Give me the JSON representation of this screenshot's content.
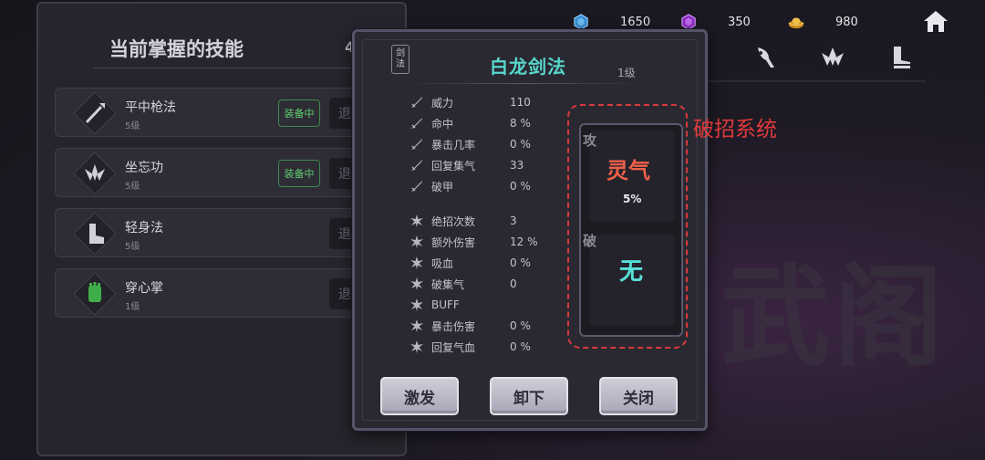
{
  "background": {
    "watermark": "武阁"
  },
  "currency": [
    {
      "icon": "blue-gem-icon",
      "value": "1650",
      "color": "#4aa6e0"
    },
    {
      "icon": "purple-gem-icon",
      "value": "350",
      "color": "#b04ae0"
    },
    {
      "icon": "gold-ingot-icon",
      "value": "980",
      "color": "#e0a83a"
    }
  ],
  "skills_panel": {
    "title": "当前掌握的技能",
    "count": "4",
    "items": [
      {
        "name": "平中枪法",
        "level": "5级",
        "equipped": "装备中",
        "action": "退",
        "icon": "spear-icon"
      },
      {
        "name": "坐忘功",
        "level": "5级",
        "equipped": "装备中",
        "action": "退",
        "icon": "lotus-icon"
      },
      {
        "name": "轻身法",
        "level": "5级",
        "equipped": "",
        "action": "退",
        "icon": "boot-icon"
      },
      {
        "name": "穿心掌",
        "level": "1级",
        "equipped": "",
        "action": "退",
        "icon": "palm-icon"
      }
    ]
  },
  "modal": {
    "category": "剑法",
    "title": "白龙剑法",
    "level": "1级",
    "weapon_stats": [
      {
        "label": "威力",
        "value": "110"
      },
      {
        "label": "命中",
        "value": "8 %"
      },
      {
        "label": "暴击几率",
        "value": "0 %"
      },
      {
        "label": "回复集气",
        "value": "33"
      },
      {
        "label": "破甲",
        "value": "0 %"
      }
    ],
    "special_stats": [
      {
        "label": "绝招次数",
        "value": "3"
      },
      {
        "label": "额外伤害",
        "value": "12 %"
      },
      {
        "label": "吸血",
        "value": "0 %"
      },
      {
        "label": "破集气",
        "value": "0"
      },
      {
        "label": "BUFF",
        "value": ""
      },
      {
        "label": "暴击伤害",
        "value": "0 %"
      },
      {
        "label": "回复气血",
        "value": "0 %"
      }
    ],
    "attack": {
      "tag": "攻",
      "name": "灵气",
      "percent": "5%"
    },
    "break": {
      "tag": "破",
      "name": "无"
    },
    "buttons": {
      "activate": "激发",
      "unequip": "卸下",
      "close": "关闭"
    }
  },
  "annotation": {
    "label": "破招系统",
    "color": "#e03a3a"
  }
}
